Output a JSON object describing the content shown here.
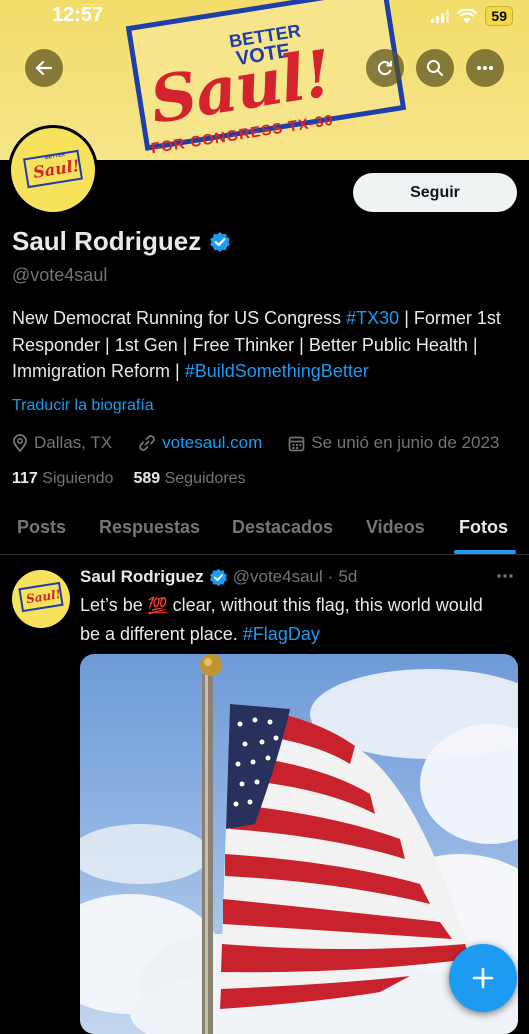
{
  "status_bar": {
    "time": "12:57",
    "battery": "59"
  },
  "banner": {
    "logo_better": "BETTER",
    "logo_vote": "VOTE",
    "logo_name": "Saul!",
    "logo_sub": "FOR CONGRESS TX-30",
    "bg_color": "#f6e58a"
  },
  "profile": {
    "follow_label": "Seguir",
    "display_name": "Saul Rodriguez",
    "handle": "@vote4saul",
    "bio_parts": {
      "p1": "New Democrat Running for US Congress ",
      "tag1": "#TX30",
      "p2": " | Former 1st Responder | 1st Gen | Free Thinker | Better Public Health | Immigration Reform | ",
      "tag2": "#BuildSomethingBetter"
    },
    "translate": "Traducir la biografía",
    "location": "Dallas, TX",
    "website": "votesaul.com",
    "joined": "Se unió en junio de 2023",
    "following_count": "117",
    "following_label": "Siguiendo",
    "followers_count": "589",
    "followers_label": "Seguidores"
  },
  "tabs": [
    "Posts",
    "Respuestas",
    "Destacados",
    "Videos",
    "Fotos"
  ],
  "active_tab": "Fotos",
  "post": {
    "name": "Saul Rodriguez",
    "handle": "@vote4saul",
    "dot": "·",
    "age": "5d",
    "text1": "Let’s be ",
    "emoji": "💯",
    "text2": " clear, without this flag, this world would be a different place. ",
    "hashtag": "#FlagDay"
  },
  "icons": [
    "back-arrow-icon",
    "refresh-icon",
    "search-icon",
    "more-icon",
    "verified-badge-icon",
    "location-icon",
    "link-icon",
    "calendar-icon",
    "compose-plus-icon"
  ],
  "colors": {
    "accent": "#1d9bf0",
    "background": "#000000",
    "muted": "#71767b",
    "flag_red": "#c8232c"
  }
}
